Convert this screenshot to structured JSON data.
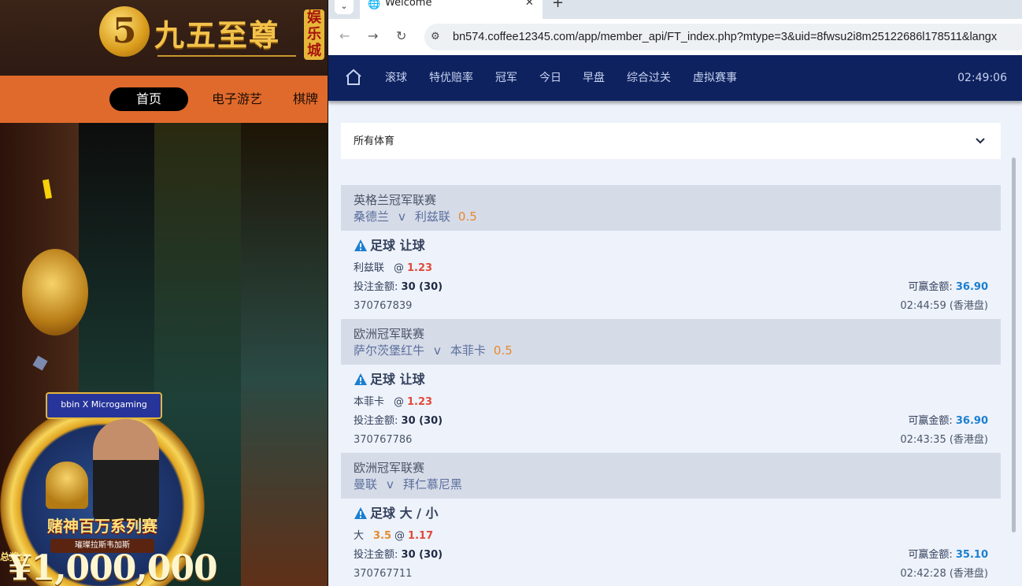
{
  "left_site": {
    "logo_mark": "5",
    "logo_text": "九五至尊",
    "logo_tag": "娱乐城",
    "nav_items": [
      "首页",
      "电子游艺",
      "棋牌"
    ],
    "promo_badge": "bbin X Microgaming",
    "promo_title": "赌神百万系列赛",
    "promo_sub": "璀璨拉斯韦加斯",
    "jackpot_label": "总奖金",
    "jackpot": "¥1,000,000"
  },
  "browser": {
    "tab_title": "Welcome",
    "tab_close": "✕",
    "new_tab": "+",
    "url": "bn574.coffee12345.com/app/member_api/FT_index.php?mtype=3&uid=8fwsu2i8m25122686l178511&langx"
  },
  "header": {
    "menu": [
      "滚球",
      "特优赔率",
      "冠军",
      "今日",
      "早盘",
      "综合过关",
      "虚拟赛事"
    ],
    "clock": "02:49:06"
  },
  "sport_filter": {
    "label": "所有体育"
  },
  "bets": [
    {
      "league": "英格兰冠军联赛",
      "home": "桑德兰",
      "vs": "v",
      "away": "利兹联",
      "handicap": "0.5",
      "bet_type": "足球 让球",
      "selection": "利兹联",
      "line": "",
      "at": "@",
      "odds": "1.23",
      "stake_label": "投注金额:",
      "stake": "30 (30)",
      "win_label": "可赢金额:",
      "win": "36.90",
      "ticket": "370767839",
      "time": "02:44:59 (香港盘)"
    },
    {
      "league": "欧洲冠军联赛",
      "home": "萨尔茨堡红牛",
      "vs": "v",
      "away": "本菲卡",
      "handicap": "0.5",
      "bet_type": "足球 让球",
      "selection": "本菲卡",
      "line": "",
      "at": "@",
      "odds": "1.23",
      "stake_label": "投注金额:",
      "stake": "30 (30)",
      "win_label": "可赢金额:",
      "win": "36.90",
      "ticket": "370767786",
      "time": "02:43:35 (香港盘)"
    },
    {
      "league": "欧洲冠军联赛",
      "home": "曼联",
      "vs": "v",
      "away": "拜仁慕尼黑",
      "handicap": "",
      "bet_type": "足球 大 / 小",
      "selection": "大",
      "line": "3.5",
      "at": "@",
      "odds": "1.17",
      "stake_label": "投注金额:",
      "stake": "30 (30)",
      "win_label": "可赢金额:",
      "win": "35.10",
      "ticket": "370767711",
      "time": "02:42:28 (香港盘)"
    }
  ],
  "colors": {
    "header_bg": "#0e2260",
    "odds": "#e04a3a",
    "win": "#1a7fd1",
    "handicap": "#e58a2c"
  }
}
